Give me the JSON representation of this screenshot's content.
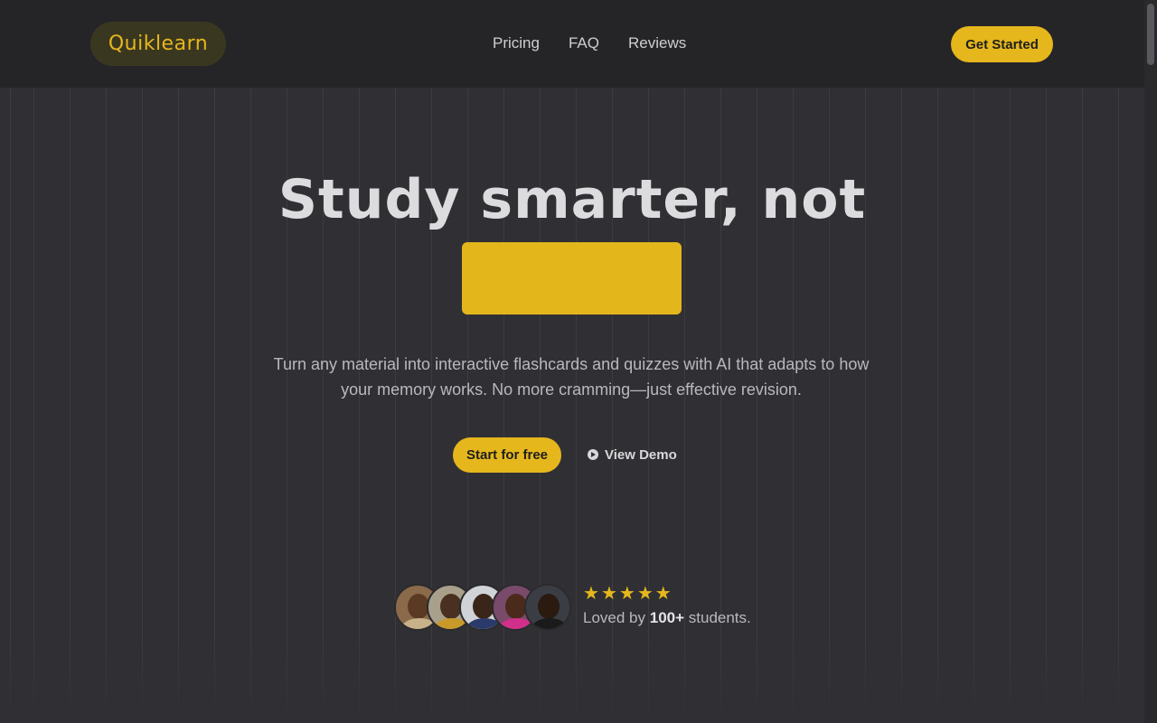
{
  "header": {
    "logo": "Quiklearn",
    "nav": [
      "Pricing",
      "FAQ",
      "Reviews"
    ],
    "cta": "Get Started"
  },
  "hero": {
    "title": "Study smarter, not",
    "subtitle": "Turn any material into interactive flashcards and quizzes with AI that adapts to how your memory works. No more cramming—just effective revision.",
    "primary_button": "Start for free",
    "secondary_button": "View Demo"
  },
  "social_proof": {
    "rating_stars": 5,
    "loved_prefix": "Loved by",
    "loved_count": "100+",
    "loved_suffix": "students.",
    "avatars": [
      "student-avatar-1",
      "student-avatar-2",
      "student-avatar-3",
      "student-avatar-4",
      "student-avatar-5"
    ]
  },
  "colors": {
    "accent": "#e6b71c",
    "background": "#303034",
    "header_bg": "#252528"
  }
}
